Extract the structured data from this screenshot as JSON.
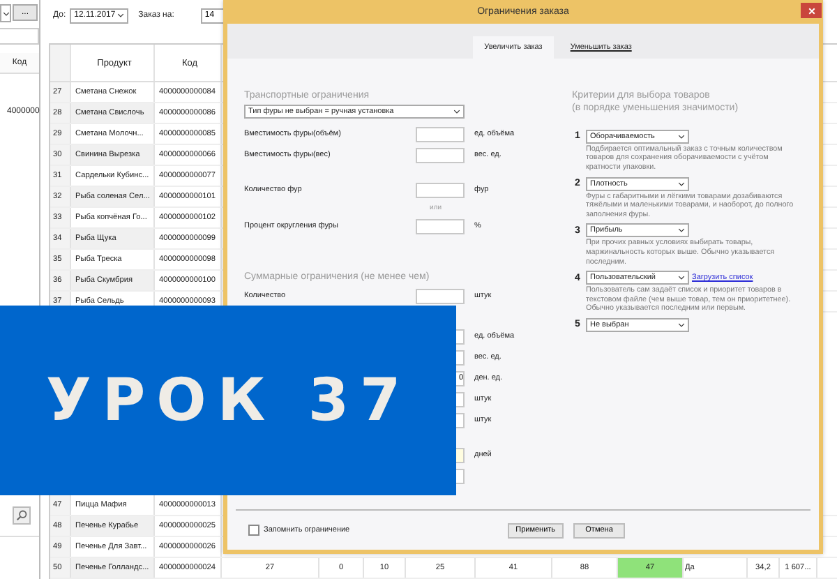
{
  "app": {
    "side_panel": {
      "browse_button": "...",
      "column_header": "Код",
      "cell": "4000000"
    },
    "toolbar": {
      "date_label": "До:",
      "date_value": "12.11.2017",
      "order_label": "Заказ на:",
      "order_value": "14"
    },
    "table": {
      "columns": [
        "Продукт",
        "Код"
      ],
      "row_blocks": [
        [
          {
            "number": "27",
            "product": "Сметана Снежок",
            "code": "4000000000084"
          },
          {
            "number": "28",
            "product": "Сметана Свислочь",
            "code": "4000000000086"
          },
          {
            "number": "29",
            "product": "Сметана Молочн...",
            "code": "4000000000085"
          },
          {
            "number": "30",
            "product": "Свинина Вырезка",
            "code": "4000000000066"
          },
          {
            "number": "31",
            "product": "Сардельки Кубинс...",
            "code": "4000000000077"
          },
          {
            "number": "32",
            "product": "Рыба соленая Сел...",
            "code": "4000000000101"
          },
          {
            "number": "33",
            "product": "Рыба копчёная Го...",
            "code": "4000000000102"
          },
          {
            "number": "34",
            "product": "Рыба Щука",
            "code": "4000000000099"
          },
          {
            "number": "35",
            "product": "Рыба Треска",
            "code": "4000000000098"
          },
          {
            "number": "36",
            "product": "Рыба Скумбрия",
            "code": "4000000000100"
          },
          {
            "number": "37",
            "product": "Рыба Сельдь",
            "code": "4000000000093"
          }
        ],
        [
          {
            "number": "47",
            "product": "Пицца Мафия",
            "code": "4000000000013"
          },
          {
            "number": "48",
            "product": "Печенье Курабье",
            "code": "4000000000025"
          },
          {
            "number": "49",
            "product": "Печенье Для Завт...",
            "code": "4000000000026"
          },
          {
            "number": "50",
            "product": "Печенье Голландс...",
            "code": "4000000000024",
            "more_cells": [
              {
                "text": "27",
                "highlighted": false
              },
              {
                "text": "0",
                "highlighted": false
              },
              {
                "text": "10",
                "highlighted": false
              },
              {
                "text": "25",
                "highlighted": false
              },
              {
                "text": "41",
                "highlighted": false
              },
              {
                "text": "88",
                "highlighted": false
              },
              {
                "text": "47",
                "highlighted": true
              },
              {
                "text": "Да",
                "highlighted": false
              },
              {
                "text": "34,2",
                "highlighted": false
              },
              {
                "text": "1 607...",
                "highlighted": false
              }
            ]
          }
        ]
      ]
    }
  },
  "dialog": {
    "title": "Ограничения заказа",
    "tabs": [
      {
        "label": "Увеличить заказ",
        "selected": true
      },
      {
        "label": "Уменьшить заказ",
        "selected": false
      }
    ],
    "transport": {
      "heading": "Транспортные ограничения",
      "truck_type": "Тип фуры не выбран = ручная установка",
      "capacity_fields": [
        {
          "label": "Вместимость фуры(объём)",
          "unit": "ед. объёма"
        },
        {
          "label": "Вместимость фуры(вес)",
          "unit": "вес. ед."
        }
      ],
      "count_field": {
        "label": "Количество фур",
        "unit": "фур"
      },
      "alternative": "или",
      "rounding_field": {
        "label": "Процент округления фуры",
        "unit": "%"
      }
    },
    "totals": {
      "heading": "Суммарные ограничения (не менее чем)",
      "fields": [
        {
          "label": "Количество",
          "unit": "штук"
        },
        {
          "unit": "ед. объёма"
        },
        {
          "unit": "вес. ед."
        },
        {
          "unit": "ден. ед.",
          "value": "0"
        },
        {
          "unit": "штук"
        },
        {
          "unit": "штук"
        }
      ],
      "period_fields": [
        {
          "unit": "дней",
          "highlighted": true
        },
        {
          "highlighted": false
        }
      ]
    },
    "criteria": {
      "heading": "Критерии для выбора товаров",
      "subheading": "(в порядке уменьшения значимости)",
      "items": [
        {
          "number": "1",
          "choice": "Оборачиваемость",
          "description": "Подбирается оптимальный заказ с точным количеством товаров для сохранения оборачиваемости с учётом кратности упаковки."
        },
        {
          "number": "2",
          "choice": "Плотность",
          "description": "Фуры с габаритными и лёгкими товарами дозабиваются тяжёлыми и маленькими товарами, и наоборот, до полного заполнения фуры."
        },
        {
          "number": "3",
          "choice": "Прибыль",
          "description": "При прочих равных условиях выбирать товары, маржинальность которых выше. Обычно указывается последним."
        },
        {
          "number": "4",
          "choice": "Пользовательский",
          "link": "Загрузить список",
          "description": "Пользователь сам задаёт список и приоритет товаров в текстовом файле (чем выше товар, тем он приоритетнее). Обычно указывается последним или первым."
        },
        {
          "number": "5",
          "choice": "Не выбран"
        }
      ]
    },
    "remember": {
      "label": "Запомнить ограничение",
      "checked": false
    },
    "buttons": [
      "Применить",
      "Отмена"
    ]
  },
  "banner": {
    "text": "УРОК 37"
  }
}
